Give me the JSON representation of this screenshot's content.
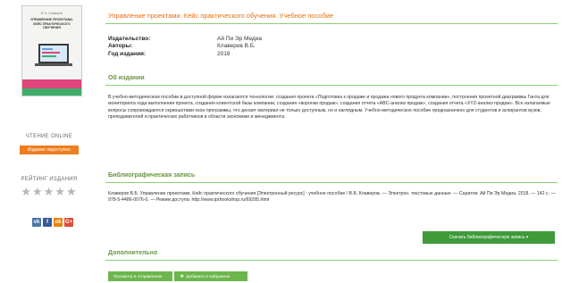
{
  "book": {
    "title": "Управление проектами. Кейс практического обучения. Учебное пособие",
    "cover_author": "В. Б. Клаверов",
    "cover_title": "УПРАВЛЕНИЕ ПРОЕКТАМИ. КЕЙС ПРАКТИЧЕСКОГО ОБУЧЕНИЯ"
  },
  "meta": [
    {
      "key": "Издательство:",
      "value": "Ай Пи Эр Медиа"
    },
    {
      "key": "Авторы:",
      "value": "Клаверов В.Б."
    },
    {
      "key": "Год издания:",
      "value": "2018"
    }
  ],
  "sidebar": {
    "read_online": "ЧТЕНИЕ ONLINE",
    "publisher_btn": "Издание недоступно",
    "rating_label": "РЕЙТИНГ ИЗДАНИЯ",
    "stars": "★★★★★",
    "rating_value": 0,
    "social": [
      "vk",
      "f",
      "ok",
      "G+"
    ]
  },
  "about": {
    "heading": "Об издании",
    "text": "В учебно-методическом пособии в доступной форме излагаются технологии: создания проекта «Подготовка к продаже и продажа нового продукта компании», построения проектной диаграммы Ганта для мониторинга хода выполнения проекта, создания клиентской базы компании, создания «воронки продаж», создания отчета «ABC-анализ продаж», создания отчета «XYZ-анализ продаж». Все излагаемые вопросы сопровождаются скриншотами окон программы, что делает материал не только доступным, но и наглядным. Учебно-методическое пособие предназначено для студентов и аспирантов вузов, преподавателей и практических работников в области экономики и менеджмента."
  },
  "biblio": {
    "heading": "Библиографическая запись",
    "text": "Клаверов В.Б. Управление проектами. Кейс практического обучения [Электронный ресурс] : учебное пособие / В.Б. Клаверов. — Электрон. текстовые данные. — Саратов: Ай Пи Эр Медиа, 2018. — 142 c. — 978-5-4486-0076-0. — Режим доступа: http://www.iprbookshop.ru/69295.html",
    "download_btn": "Скачать библиографическую запись ▾"
  },
  "extra": {
    "heading": "Дополнительно",
    "btn_error": "Просмотр и отправление",
    "btn_fav": "Добавить в избранное"
  },
  "colors": {
    "accent_orange": "#e86d10",
    "green_heading": "#6a9444",
    "green_button": "#3f9a3a"
  }
}
